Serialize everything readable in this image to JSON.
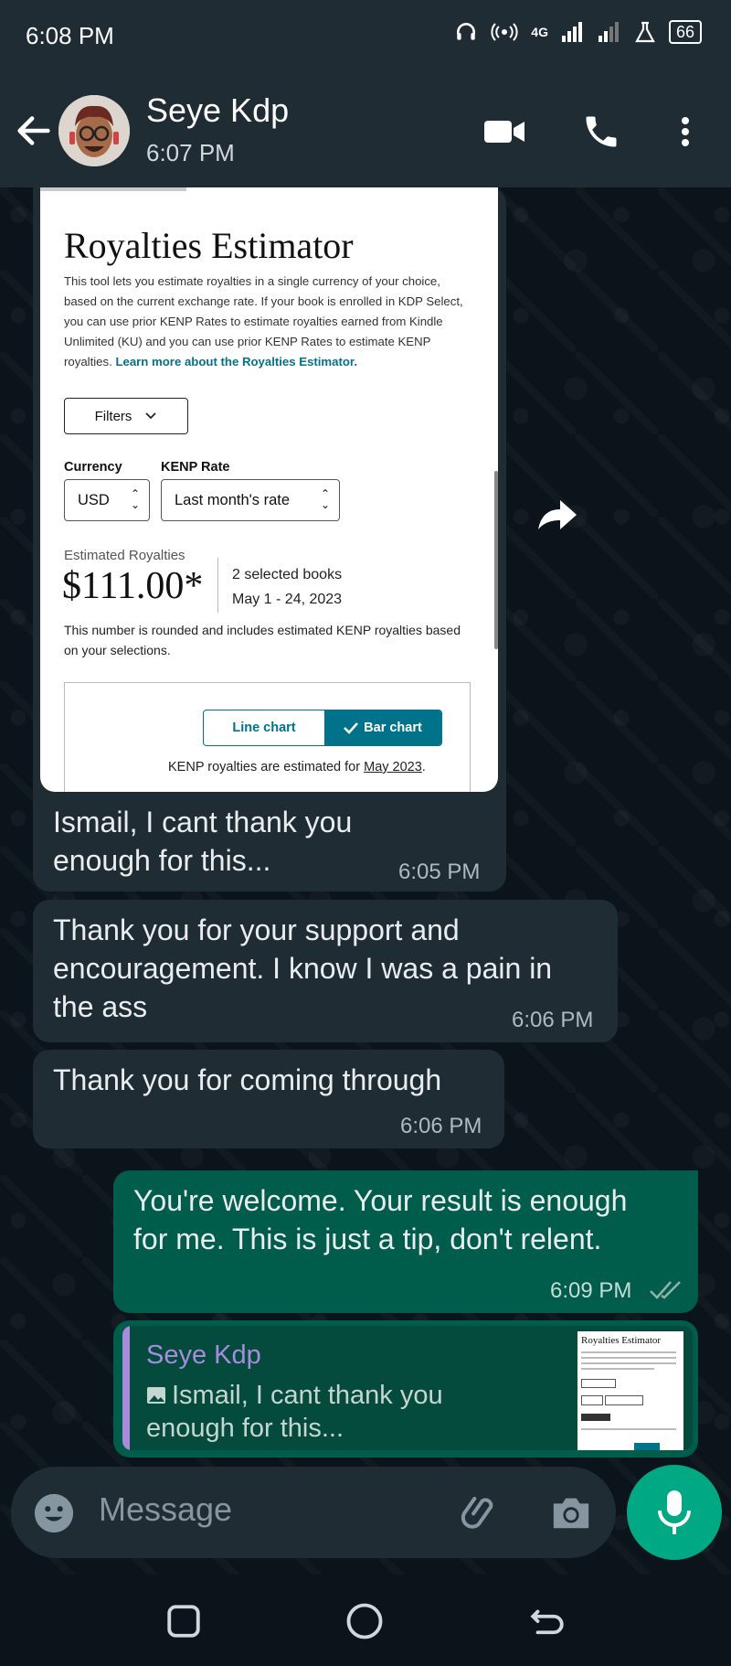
{
  "status_bar": {
    "time": "6:08 PM",
    "network": "4G",
    "battery": "66"
  },
  "header": {
    "contact_name": "Seye Kdp",
    "contact_status": "6:07 PM"
  },
  "shared_image": {
    "title": "Royalties Estimator",
    "description": "This tool lets you estimate royalties in a single currency of your choice, based on the current exchange rate. If your book is enrolled in KDP Select, you can use prior KENP Rates to estimate royalties earned from Kindle Unlimited (KU) and you can use prior KENP Rates to estimate KENP royalties.",
    "learn_more": "Learn more about the Royalties Estimator.",
    "filters_label": "Filters",
    "currency_label": "Currency",
    "currency_value": "USD",
    "kenp_label": "KENP Rate",
    "kenp_value": "Last month's rate",
    "estimated_label": "Estimated Royalties",
    "estimated_value": "$111.00*",
    "selected_books": "2 selected books",
    "date_range": "May 1 - 24, 2023",
    "note": "This number is rounded and includes estimated KENP royalties based on your selections.",
    "line_chart_label": "Line chart",
    "bar_chart_label": "Bar chart",
    "kenp_note_prefix": "KENP royalties are estimated for",
    "kenp_note_month": "May 2023",
    "kenp_note_suffix": "."
  },
  "messages": [
    {
      "direction": "in",
      "text": "Ismail, I cant thank you enough for this...",
      "time": "6:05 PM"
    },
    {
      "direction": "in",
      "text": "Thank you for your support and encouragement. I know I was a pain in the ass",
      "time": "6:06 PM"
    },
    {
      "direction": "in",
      "text": "Thank you for coming through",
      "time": "6:06 PM"
    },
    {
      "direction": "out",
      "text": "You're welcome. Your result is enough for me. This is just a tip, don't relent.",
      "time": "6:09 PM",
      "status": "read"
    }
  ],
  "reply_quote": {
    "author": "Seye Kdp",
    "text": "Ismail, I cant thank you enough for this...",
    "thumb_title": "Royalties Estimator"
  },
  "input": {
    "placeholder": "Message"
  },
  "colors": {
    "header_bg": "#1f2c34",
    "incoming_bubble": "#202c33",
    "outgoing_bubble": "#005c4b",
    "accent": "#00a884",
    "quote_author": "#a78bdc"
  }
}
